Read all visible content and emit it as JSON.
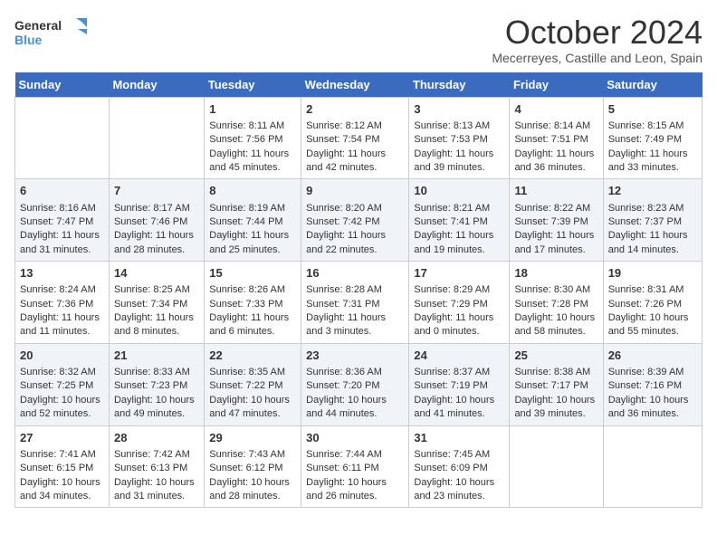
{
  "header": {
    "logo_line1": "General",
    "logo_line2": "Blue",
    "title": "October 2024",
    "subtitle": "Mecerreyes, Castille and Leon, Spain"
  },
  "weekdays": [
    "Sunday",
    "Monday",
    "Tuesday",
    "Wednesday",
    "Thursday",
    "Friday",
    "Saturday"
  ],
  "weeks": [
    [
      {
        "day": "",
        "info": ""
      },
      {
        "day": "",
        "info": ""
      },
      {
        "day": "1",
        "info": "Sunrise: 8:11 AM\nSunset: 7:56 PM\nDaylight: 11 hours and 45 minutes."
      },
      {
        "day": "2",
        "info": "Sunrise: 8:12 AM\nSunset: 7:54 PM\nDaylight: 11 hours and 42 minutes."
      },
      {
        "day": "3",
        "info": "Sunrise: 8:13 AM\nSunset: 7:53 PM\nDaylight: 11 hours and 39 minutes."
      },
      {
        "day": "4",
        "info": "Sunrise: 8:14 AM\nSunset: 7:51 PM\nDaylight: 11 hours and 36 minutes."
      },
      {
        "day": "5",
        "info": "Sunrise: 8:15 AM\nSunset: 7:49 PM\nDaylight: 11 hours and 33 minutes."
      }
    ],
    [
      {
        "day": "6",
        "info": "Sunrise: 8:16 AM\nSunset: 7:47 PM\nDaylight: 11 hours and 31 minutes."
      },
      {
        "day": "7",
        "info": "Sunrise: 8:17 AM\nSunset: 7:46 PM\nDaylight: 11 hours and 28 minutes."
      },
      {
        "day": "8",
        "info": "Sunrise: 8:19 AM\nSunset: 7:44 PM\nDaylight: 11 hours and 25 minutes."
      },
      {
        "day": "9",
        "info": "Sunrise: 8:20 AM\nSunset: 7:42 PM\nDaylight: 11 hours and 22 minutes."
      },
      {
        "day": "10",
        "info": "Sunrise: 8:21 AM\nSunset: 7:41 PM\nDaylight: 11 hours and 19 minutes."
      },
      {
        "day": "11",
        "info": "Sunrise: 8:22 AM\nSunset: 7:39 PM\nDaylight: 11 hours and 17 minutes."
      },
      {
        "day": "12",
        "info": "Sunrise: 8:23 AM\nSunset: 7:37 PM\nDaylight: 11 hours and 14 minutes."
      }
    ],
    [
      {
        "day": "13",
        "info": "Sunrise: 8:24 AM\nSunset: 7:36 PM\nDaylight: 11 hours and 11 minutes."
      },
      {
        "day": "14",
        "info": "Sunrise: 8:25 AM\nSunset: 7:34 PM\nDaylight: 11 hours and 8 minutes."
      },
      {
        "day": "15",
        "info": "Sunrise: 8:26 AM\nSunset: 7:33 PM\nDaylight: 11 hours and 6 minutes."
      },
      {
        "day": "16",
        "info": "Sunrise: 8:28 AM\nSunset: 7:31 PM\nDaylight: 11 hours and 3 minutes."
      },
      {
        "day": "17",
        "info": "Sunrise: 8:29 AM\nSunset: 7:29 PM\nDaylight: 11 hours and 0 minutes."
      },
      {
        "day": "18",
        "info": "Sunrise: 8:30 AM\nSunset: 7:28 PM\nDaylight: 10 hours and 58 minutes."
      },
      {
        "day": "19",
        "info": "Sunrise: 8:31 AM\nSunset: 7:26 PM\nDaylight: 10 hours and 55 minutes."
      }
    ],
    [
      {
        "day": "20",
        "info": "Sunrise: 8:32 AM\nSunset: 7:25 PM\nDaylight: 10 hours and 52 minutes."
      },
      {
        "day": "21",
        "info": "Sunrise: 8:33 AM\nSunset: 7:23 PM\nDaylight: 10 hours and 49 minutes."
      },
      {
        "day": "22",
        "info": "Sunrise: 8:35 AM\nSunset: 7:22 PM\nDaylight: 10 hours and 47 minutes."
      },
      {
        "day": "23",
        "info": "Sunrise: 8:36 AM\nSunset: 7:20 PM\nDaylight: 10 hours and 44 minutes."
      },
      {
        "day": "24",
        "info": "Sunrise: 8:37 AM\nSunset: 7:19 PM\nDaylight: 10 hours and 41 minutes."
      },
      {
        "day": "25",
        "info": "Sunrise: 8:38 AM\nSunset: 7:17 PM\nDaylight: 10 hours and 39 minutes."
      },
      {
        "day": "26",
        "info": "Sunrise: 8:39 AM\nSunset: 7:16 PM\nDaylight: 10 hours and 36 minutes."
      }
    ],
    [
      {
        "day": "27",
        "info": "Sunrise: 7:41 AM\nSunset: 6:15 PM\nDaylight: 10 hours and 34 minutes."
      },
      {
        "day": "28",
        "info": "Sunrise: 7:42 AM\nSunset: 6:13 PM\nDaylight: 10 hours and 31 minutes."
      },
      {
        "day": "29",
        "info": "Sunrise: 7:43 AM\nSunset: 6:12 PM\nDaylight: 10 hours and 28 minutes."
      },
      {
        "day": "30",
        "info": "Sunrise: 7:44 AM\nSunset: 6:11 PM\nDaylight: 10 hours and 26 minutes."
      },
      {
        "day": "31",
        "info": "Sunrise: 7:45 AM\nSunset: 6:09 PM\nDaylight: 10 hours and 23 minutes."
      },
      {
        "day": "",
        "info": ""
      },
      {
        "day": "",
        "info": ""
      }
    ]
  ]
}
